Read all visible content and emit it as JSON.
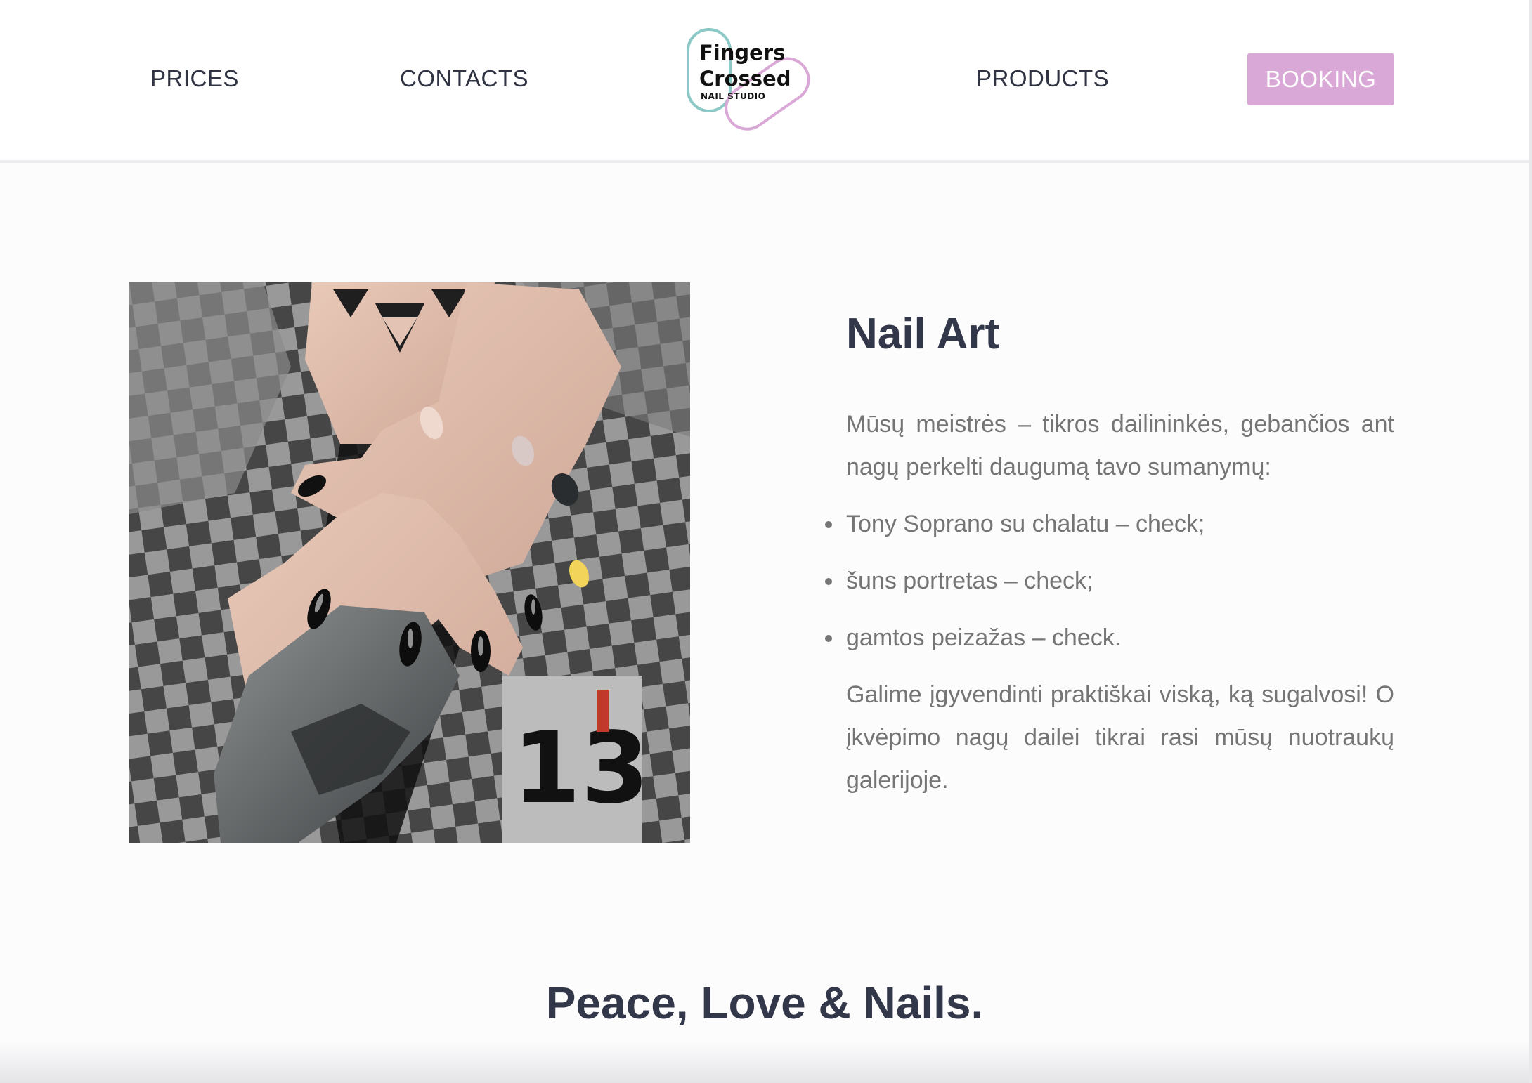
{
  "header": {
    "nav_left": [
      {
        "label": "PRICES"
      },
      {
        "label": "CONTACTS"
      }
    ],
    "nav_right": [
      {
        "label": "PRODUCTS"
      }
    ],
    "booking_label": "BOOKING",
    "logo": {
      "line1": "Fingers",
      "line2": "Crossed",
      "line3": "NAIL STUDIO"
    }
  },
  "main": {
    "image_alt": "hands with black chrome nail art over checkered denim jacket",
    "title": "Nail Art",
    "intro": "Mūsų meistrės – tikros dailininkės, gebančios ant nagų perkelti daugumą tavo sumanymų:",
    "bullets": [
      "Tony Soprano su chalatu – check;",
      "šuns portretas – check;",
      "gamtos peizažas – check."
    ],
    "outro": "Galime įgyvendinti praktiškai viską, ką sugalvosi! O įkvėpimo nagų dailei tikrai rasi mūsų nuotraukų galerijoje."
  },
  "tagline": "Peace, Love & Nails.",
  "colors": {
    "accent": "#d9a8d6",
    "logo_teal": "#8cc9c6",
    "logo_pink": "#d9a8d6",
    "heading": "#33374a",
    "body_text": "#757575"
  }
}
